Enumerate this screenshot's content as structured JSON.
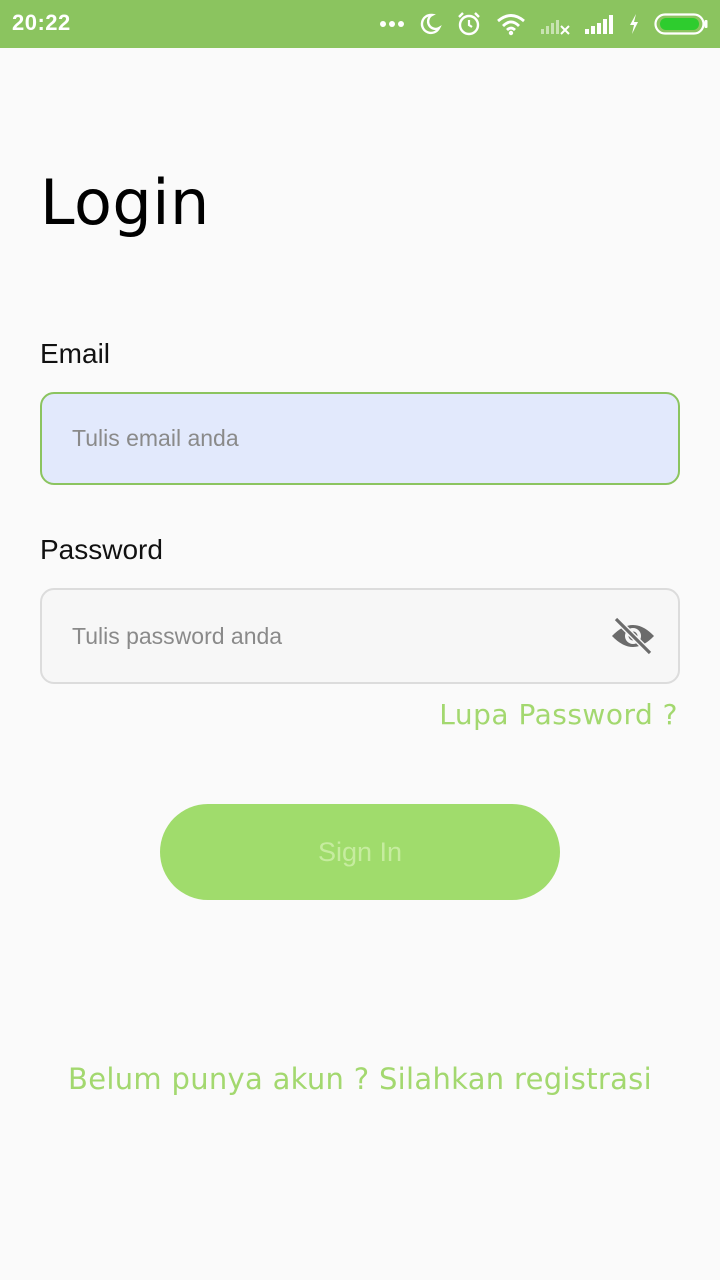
{
  "status_bar": {
    "time": "20:22",
    "icons": [
      "more-dots-icon",
      "moon-icon",
      "alarm-icon",
      "wifi-icon",
      "signal-no-service-icon",
      "signal-icon",
      "charging-icon",
      "battery-icon"
    ],
    "color": "#8bc45f"
  },
  "page": {
    "title": "Login"
  },
  "form": {
    "email_label": "Email",
    "email_placeholder": "Tulis email anda",
    "email_value": "",
    "password_label": "Password",
    "password_placeholder": "Tulis password anda",
    "password_value": "",
    "password_toggle_icon": "eye-off-icon",
    "forgot_password": "Lupa Password ?",
    "submit_label": "Sign In"
  },
  "footer": {
    "register_text": "Belum punya akun ? Silahkan registrasi"
  },
  "colors": {
    "accent": "#8bc45f",
    "link": "#a3d86f",
    "button": "#a0dc6c",
    "email_field_bg": "#e2e9fc"
  }
}
